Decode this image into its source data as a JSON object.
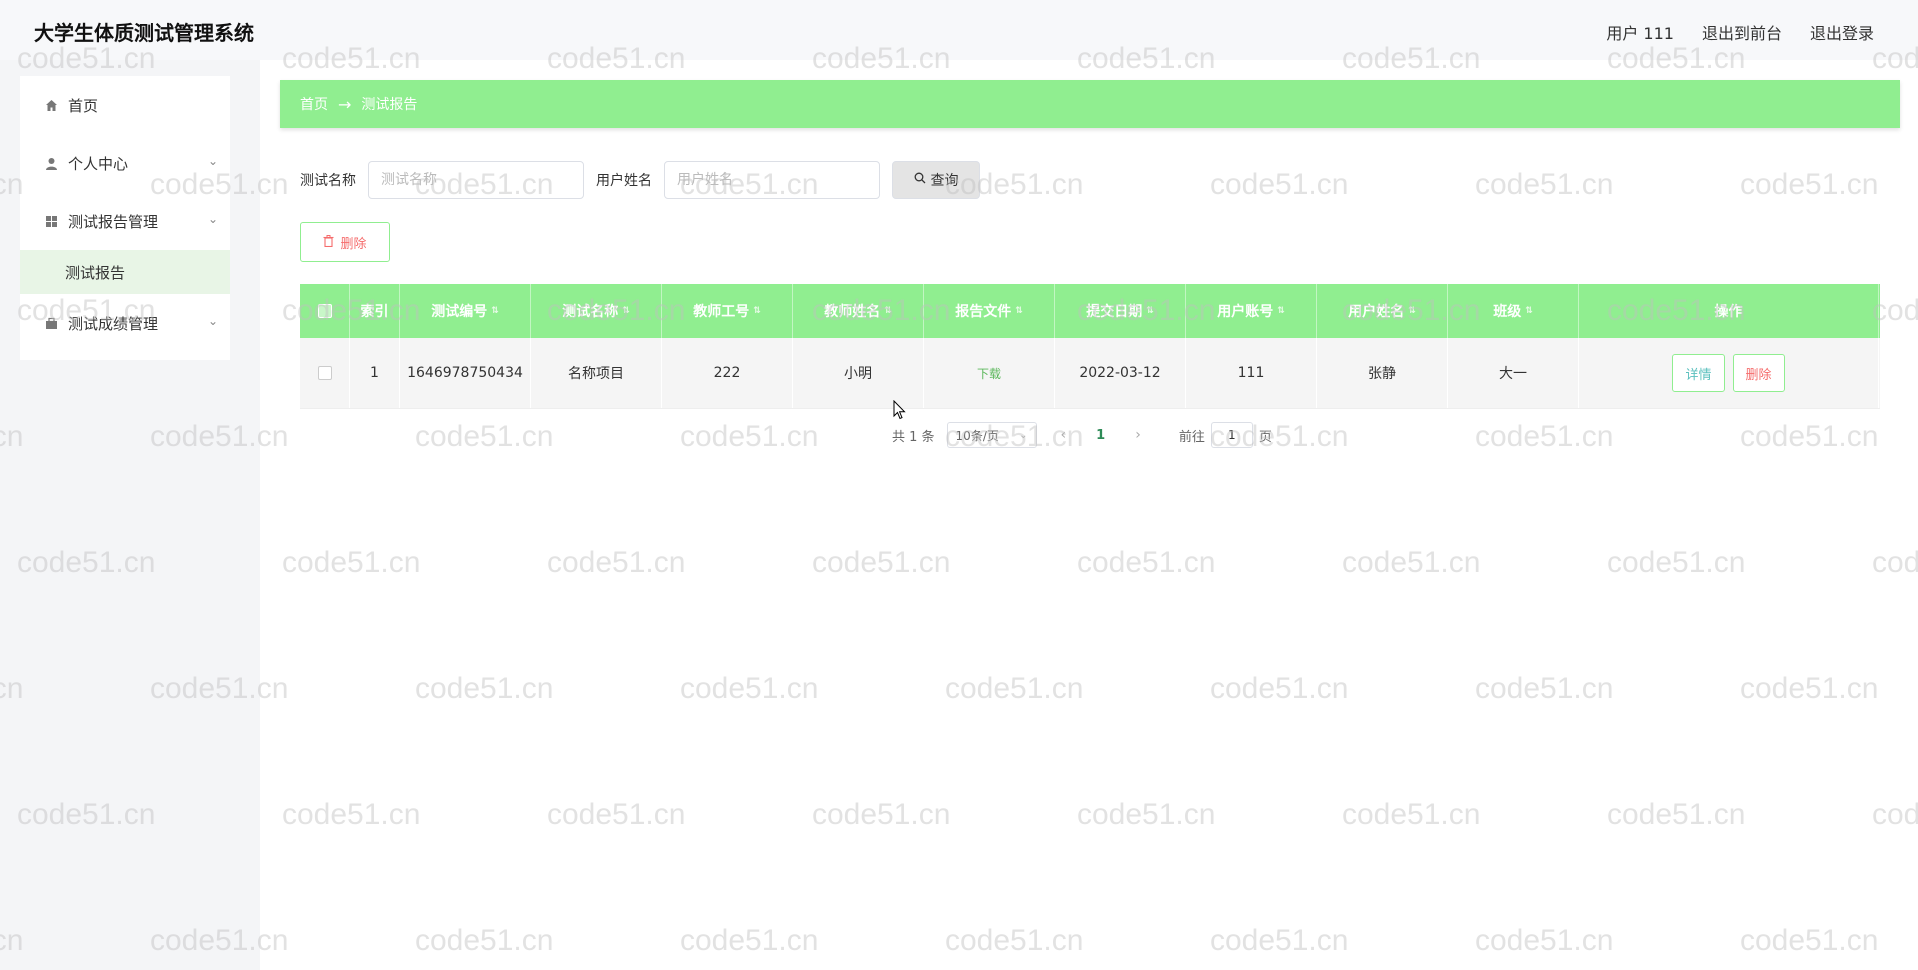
{
  "header": {
    "app_title": "大学生体质测试管理系统",
    "user_label": "用户 111",
    "exit_front": "退出到前台",
    "logout": "退出登录"
  },
  "sidebar": {
    "items": [
      {
        "label": "首页",
        "icon": "home-icon"
      },
      {
        "label": "个人中心",
        "icon": "user-icon",
        "expandable": true
      },
      {
        "label": "测试报告管理",
        "icon": "grid-icon",
        "expandable": true
      },
      {
        "label": "测试成绩管理",
        "icon": "briefcase-icon",
        "expandable": true
      }
    ],
    "submenu_active": "测试报告"
  },
  "breadcrumb": {
    "home": "首页",
    "separator": "→",
    "current": "测试报告"
  },
  "search": {
    "test_name_label": "测试名称",
    "test_name_placeholder": "测试名称",
    "user_name_label": "用户姓名",
    "user_name_placeholder": "用户姓名",
    "query_button": "查询"
  },
  "actions": {
    "delete_button": "删除"
  },
  "table": {
    "columns": [
      "",
      "索引",
      "测试编号",
      "测试名称",
      "教师工号",
      "教师姓名",
      "报告文件",
      "提交日期",
      "用户账号",
      "用户姓名",
      "班级",
      "操作"
    ],
    "rows": [
      {
        "index": "1",
        "test_no": "1646978750434",
        "test_name": "名称项目",
        "teacher_id": "222",
        "teacher_name": "小明",
        "report_file": "下载",
        "submit_date": "2022-03-12",
        "user_account": "111",
        "user_name": "张静",
        "class": "大一",
        "detail_button": "详情",
        "delete_button": "删除"
      }
    ]
  },
  "pagination": {
    "total": "共 1 条",
    "page_size": "10条/页",
    "current_page": "1",
    "goto_label": "前往",
    "goto_value": "1",
    "page_suffix": "页"
  },
  "watermark": "code51.cn",
  "colors": {
    "accent_green": "#90ee90",
    "danger_red": "#f56c6c"
  }
}
